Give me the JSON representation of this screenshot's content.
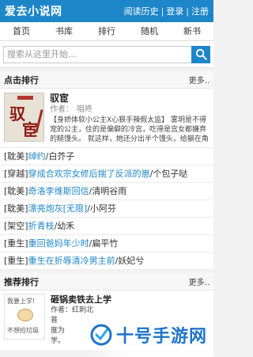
{
  "header": {
    "brand": "爱去小说网",
    "links": [
      "阅读历史",
      "登录",
      "注册"
    ],
    "separator": "|"
  },
  "nav": [
    "首页",
    "书库",
    "排行",
    "随机",
    "新书"
  ],
  "search": {
    "placeholder": "搜索从这里开始..."
  },
  "ranking": {
    "title": "点击排行",
    "more": "更多..",
    "feature": {
      "title": "驭宦",
      "author_label": "作者：",
      "author": "咀咚",
      "description": "【身娇体软小公主X心狠手辣假太监】 雾玥是不得宠的公主，住的是偏僻的冷宫，吃得是宫女都嫌弃的糙馒头。 就这样，她还分出半个馒头，给躺在角落半死不活"
    },
    "rows": [
      {
        "category": "[耽美]",
        "name": "绰约",
        "author": "白芥子"
      },
      {
        "category": "[穿越]",
        "name": "穿成合欢宗女修后揣了反派的崽",
        "author": "个包子哒"
      },
      {
        "category": "[耽美]",
        "name": "奇洛李维斯回信",
        "author": "清明谷雨"
      },
      {
        "category": "[耽美]",
        "name": "漂亮炮灰[无限]",
        "author": "小阿芬"
      },
      {
        "category": "[架空]",
        "name": "折青枝",
        "author": "幼禾"
      },
      {
        "category": "[重生]",
        "name": "重回爸妈年少时",
        "author": "扁平竹"
      },
      {
        "category": "[重生]",
        "name": "重生在折辱清冷男主前",
        "author": "妖妃兮"
      }
    ]
  },
  "recommend": {
    "title": "推荐排行",
    "more": "更多..",
    "book": {
      "title": "砸锅卖铁去上学",
      "cover_top": "我要上学!",
      "cover_bottom": "不想捡垃圾",
      "snippet_lines": [
        "作者：红刺北",
        "普",
        "度为",
        "学。"
      ]
    }
  },
  "watermark": {
    "text": "十号手游网"
  },
  "colors": {
    "accent": "#1d86c9",
    "link": "#1d86c9"
  }
}
